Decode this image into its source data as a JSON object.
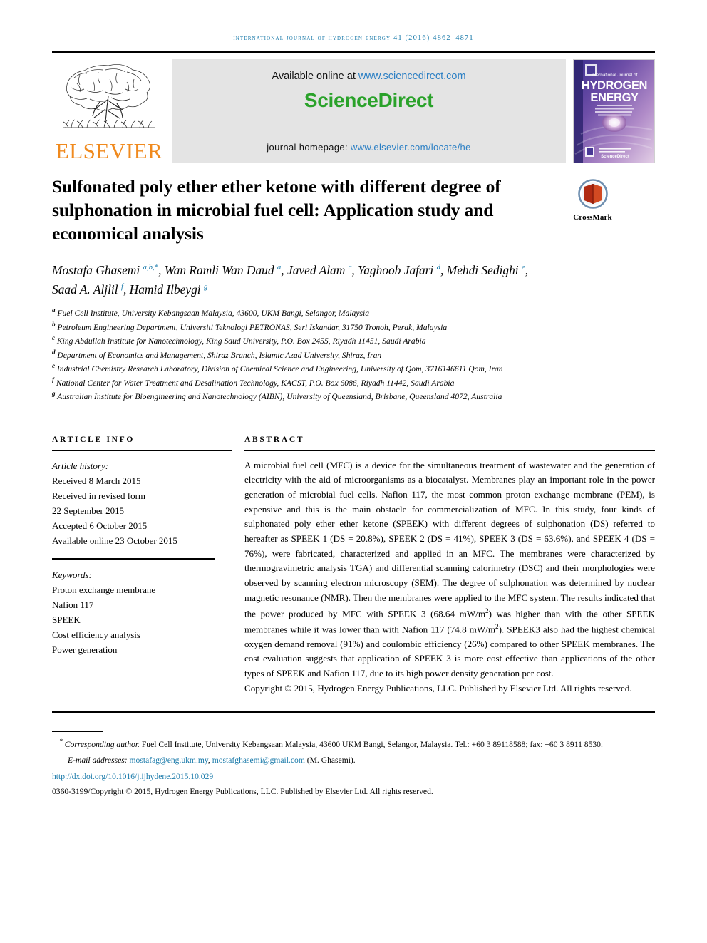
{
  "running_head": "International Journal of Hydrogen Energy 41 (2016) 4862–4871",
  "masthead": {
    "publisher_name": "ELSEVIER",
    "tree_logo_name": "elsevier-tree-logo",
    "available_prefix": "Available online at ",
    "sciencedirect_url": "www.sciencedirect.com",
    "sciencedirect_logo": "ScienceDirect",
    "homepage_prefix": "journal homepage: ",
    "homepage_url": "www.elsevier.com/locate/he",
    "cover": {
      "kicker": "International Journal of",
      "line1": "HYDROGEN",
      "line2": "ENERGY",
      "editors_block": "Editor-in-Chief: T. Nejat Veziroğlu  Associate Editors: S. Dutta, D.Y. Goswami, M.R. Islam, K.Z. Preville, J.M. Norbeck, L. Zhang, T. and D.Y. Veziroğlu",
      "footer_brand": "ScienceDirect"
    }
  },
  "title": "Sulfonated poly ether ether ketone with different degree of sulphonation in microbial fuel cell: Application study and economical analysis",
  "crossmark": {
    "label": "CrossMark",
    "icon": "crossmark-logo"
  },
  "authors": [
    {
      "name": "Mostafa Ghasemi",
      "marks": "a,b,*"
    },
    {
      "name": "Wan Ramli Wan Daud",
      "marks": "a"
    },
    {
      "name": "Javed Alam",
      "marks": "c"
    },
    {
      "name": "Yaghoob Jafari",
      "marks": "d"
    },
    {
      "name": "Mehdi Sedighi",
      "marks": "e"
    },
    {
      "name": "Saad A. Aljlil",
      "marks": "f"
    },
    {
      "name": "Hamid Ilbeygi",
      "marks": "g"
    }
  ],
  "affiliations": [
    {
      "mark": "a",
      "text": "Fuel Cell Institute, University Kebangsaan Malaysia, 43600, UKM Bangi, Selangor, Malaysia"
    },
    {
      "mark": "b",
      "text": "Petroleum Engineering Department, Universiti Teknologi PETRONAS, Seri Iskandar, 31750 Tronoh, Perak, Malaysia"
    },
    {
      "mark": "c",
      "text": "King Abdullah Institute for Nanotechnology, King Saud University, P.O. Box 2455, Riyadh 11451, Saudi Arabia"
    },
    {
      "mark": "d",
      "text": "Department of Economics and Management, Shiraz Branch, Islamic Azad University, Shiraz, Iran"
    },
    {
      "mark": "e",
      "text": "Industrial Chemistry Research Laboratory, Division of Chemical Science and Engineering, University of Qom, 3716146611 Qom, Iran"
    },
    {
      "mark": "f",
      "text": "National Center for Water Treatment and Desalination Technology, KACST, P.O. Box 6086, Riyadh 11442, Saudi Arabia"
    },
    {
      "mark": "g",
      "text": "Australian Institute for Bioengineering and Nanotechnology (AIBN), University of Queensland, Brisbane, Queensland 4072, Australia"
    }
  ],
  "article_info": {
    "heading": "ARTICLE INFO",
    "history_label": "Article history:",
    "history": [
      "Received 8 March 2015",
      "Received in revised form",
      "22 September 2015",
      "Accepted 6 October 2015",
      "Available online 23 October 2015"
    ],
    "keywords_label": "Keywords:",
    "keywords": [
      "Proton exchange membrane",
      "Nafion 117",
      "SPEEK",
      "Cost efficiency analysis",
      "Power generation"
    ]
  },
  "abstract": {
    "heading": "ABSTRACT",
    "body": "A microbial fuel cell (MFC) is a device for the simultaneous treatment of wastewater and the generation of electricity with the aid of microorganisms as a biocatalyst. Membranes play an important role in the power generation of microbial fuel cells. Nafion 117, the most common proton exchange membrane (PEM), is expensive and this is the main obstacle for commercialization of MFC. In this study, four kinds of sulphonated poly ether ether ketone (SPEEK) with different degrees of sulphonation (DS) referred to hereafter as SPEEK 1 (DS = 20.8%), SPEEK 2 (DS = 41%), SPEEK 3 (DS = 63.6%), and SPEEK 4 (DS = 76%), were fabricated, characterized and applied in an MFC. The membranes were characterized by thermogravimetric analysis TGA) and differential scanning calorimetry (DSC) and their morphologies were observed by scanning electron microscopy (SEM). The degree of sulphonation was determined by nuclear magnetic resonance (NMR). Then the membranes were applied to the MFC system. The results indicated that the power produced by MFC with SPEEK 3 (68.64 mW/m²) was higher than with the other SPEEK membranes while it was lower than with Nafion 117 (74.8 mW/m²). SPEEK3 also had the highest chemical oxygen demand removal (91%) and coulombic efficiency (26%) compared to other SPEEK membranes. The cost evaluation suggests that application of SPEEK 3 is more cost effective than applications of the other types of SPEEK and Nafion 117, due to its high power density generation per cost.",
    "copyright": "Copyright © 2015, Hydrogen Energy Publications, LLC. Published by Elsevier Ltd. All rights reserved."
  },
  "footnotes": {
    "corresponding_mark": "*",
    "corresponding_label": "Corresponding author.",
    "corresponding_text": " Fuel Cell Institute, University Kebangsaan Malaysia, 43600 UKM Bangi, Selangor, Malaysia. Tel.: +60 3 89118588; fax: +60 3 8911 8530.",
    "email_label": "E-mail addresses:",
    "email_1": "mostafag@eng.ukm.my",
    "email_separator": ", ",
    "email_2": "mostafghasemi@gmail.com",
    "email_attribution": " (M. Ghasemi).",
    "doi": "http://dx.doi.org/10.1016/j.ijhydene.2015.10.029",
    "issn_line": "0360-3199/Copyright © 2015, Hydrogen Energy Publications, LLC. Published by Elsevier Ltd. All rights reserved."
  },
  "colors": {
    "link": "#1a7aaa",
    "elsevier_orange": "#F08A1E",
    "sciencedirect_green": "#2aa22a",
    "sciencedirect_url_blue": "#2b7fc4",
    "banner_gray": "#e4e4e4"
  }
}
